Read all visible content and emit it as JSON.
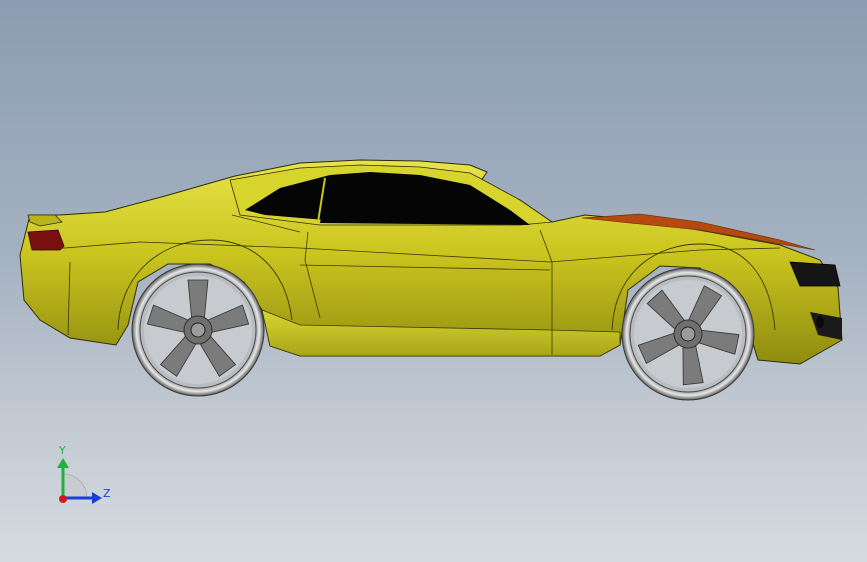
{
  "viewport": {
    "background_top": "#8b9db2",
    "background_bottom": "#d6dbe1",
    "model": {
      "icon": "sports-car-side-view",
      "body_color": "#c9c521",
      "shadow_color": "#6d6a0a",
      "glass_color": "#050505",
      "wheel_color": "#9a9a9a"
    }
  },
  "triad": {
    "y_label": "Y",
    "z_label": "Z",
    "y_color": "#1bb33a",
    "z_color": "#1a3fd6",
    "x_color": "#d11a1a"
  }
}
